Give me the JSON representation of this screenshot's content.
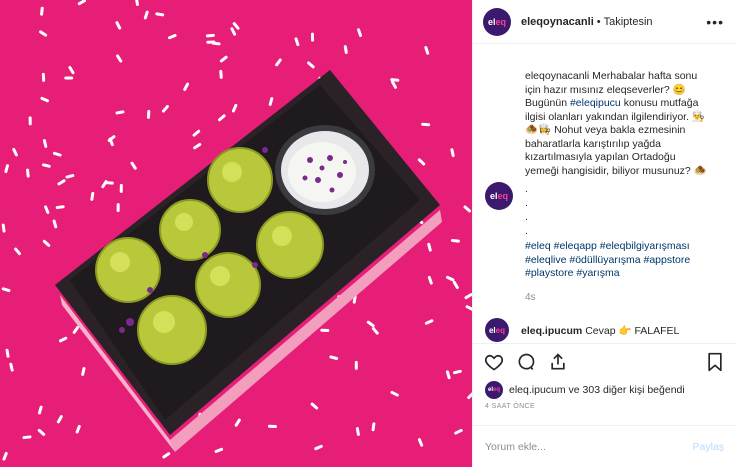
{
  "header": {
    "avatar_text_a": "el",
    "avatar_text_b": "eq",
    "username": "eleqoynacanli",
    "separator": "•",
    "follow_status": "Takiptesin",
    "more_label": "•••"
  },
  "caption": {
    "username": "eleqoynacanli",
    "text_1": "Merhabalar hafta sonu için hazır mısınız eleqseverler? 😊 Bugünün",
    "tag_1": "#eleqipucu",
    "text_2": "konusu mutfağa ilgisi olanları yakından ilgilendiriyor. 👨‍🍳🧆👩‍🍳 Nohut veya bakla ezmesinin baharatlarla karıştırılıp yağda kızartılmasıyla yapılan Ortadoğu yemeği hangisidir, biliyor musunuz? 🧆",
    "dots": [
      ".",
      ".",
      ".",
      "."
    ],
    "tags": [
      "#eleq",
      "#eleqapp",
      "#eleqbilgiyarışması",
      "#eleqlive",
      "#ödüllüyarışma",
      "#appstore",
      "#playstore",
      "#yarışma"
    ],
    "time": "4s"
  },
  "reply": {
    "username": "eleq.ipucum",
    "text": "Cevap 👉 FALAFEL"
  },
  "likes": {
    "liker": "eleq.ipucum",
    "rest": " ve 303 diğer kişi beğendi"
  },
  "ago": "4 SAAT ÖNCE",
  "comment_box": {
    "placeholder": "Yorum ekle...",
    "post_label": "Paylaş"
  },
  "icons": [
    "heart-icon",
    "comment-icon",
    "share-icon",
    "bookmark-icon"
  ],
  "colors": {
    "background": "#e61e78",
    "board": "#2a2226",
    "falafel": "#b8c83a",
    "link": "#00376b"
  }
}
